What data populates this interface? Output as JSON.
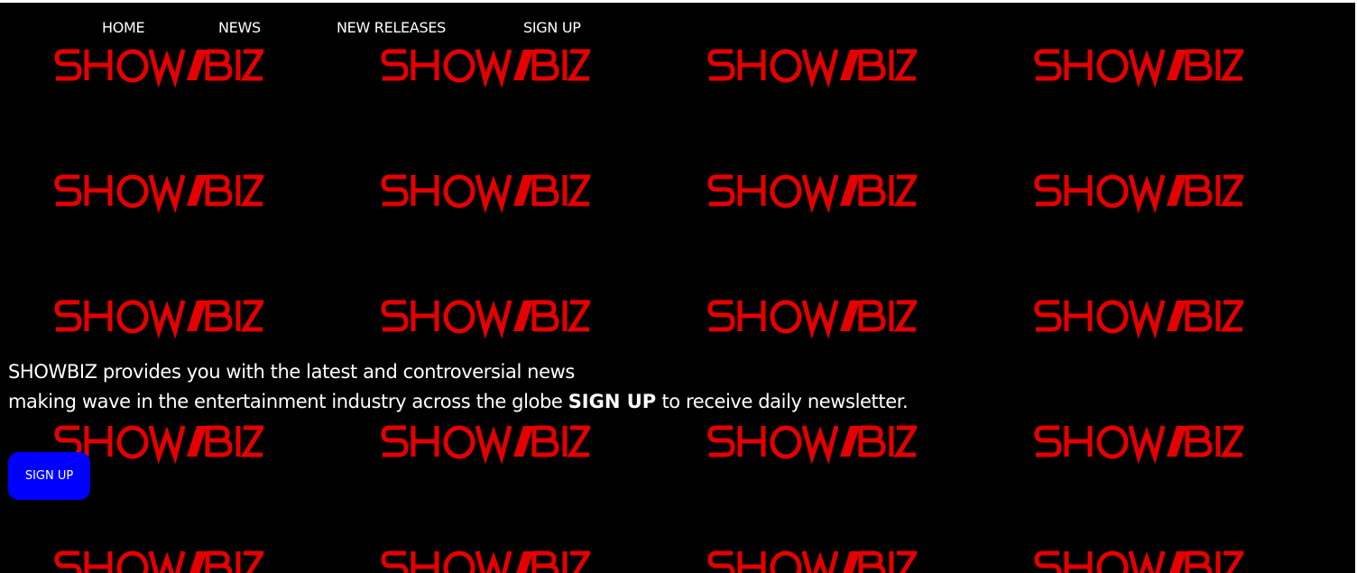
{
  "nav": {
    "home": "HOME",
    "news": "NEWS",
    "new_releases": "NEW RELEASES",
    "sign_up": "SIGN UP"
  },
  "brand": {
    "logo_text": "SHOWBIZ",
    "logo_color": "#e50000",
    "background_color": "#000000"
  },
  "intro": {
    "line1": "SHOWBIZ provides you with the latest and controversial news",
    "line2_prefix": "making wave in the entertainment industry across the globe ",
    "line2_emphasis": "SIGN UP",
    "line2_suffix": " to receive daily newsletter."
  },
  "cta": {
    "label": "SIGN UP",
    "color": "#0000ff"
  }
}
